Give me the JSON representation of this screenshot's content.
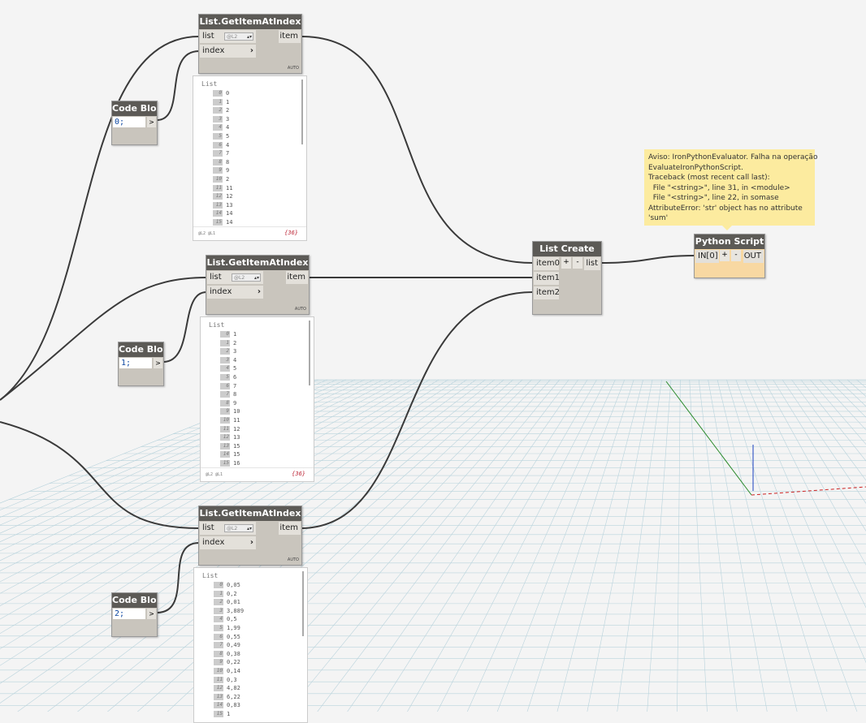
{
  "nodes": {
    "get1": {
      "title": "List.GetItemAtIndex",
      "in_list": "list",
      "in_index": "index",
      "out": "item",
      "level": "@L2",
      "lacing": "AUTO"
    },
    "get2": {
      "title": "List.GetItemAtIndex",
      "in_list": "list",
      "in_index": "index",
      "out": "item",
      "level": "@L2",
      "lacing": "AUTO"
    },
    "get3": {
      "title": "List.GetItemAtIndex",
      "in_list": "list",
      "in_index": "index",
      "out": "item",
      "level": "@L2",
      "lacing": "AUTO"
    },
    "code1": {
      "title": "Code Block",
      "code": "0;",
      "out": ">"
    },
    "code2": {
      "title": "Code Block",
      "code": "1;",
      "out": ">"
    },
    "code3": {
      "title": "Code Block",
      "code": "2;",
      "out": ">"
    },
    "listcreate": {
      "title": "List Create",
      "inputs": [
        "item0",
        "item1",
        "item2"
      ],
      "plus": "+",
      "minus": "-",
      "out": "list"
    },
    "python": {
      "title": "Python Script",
      "in": "IN[0]",
      "plus": "+",
      "minus": "-",
      "out": "OUT"
    }
  },
  "previews": [
    {
      "header": "List",
      "levels": "@L2 @L1",
      "count": "{36}",
      "rows": [
        [
          "0",
          "0"
        ],
        [
          "1",
          "1"
        ],
        [
          "2",
          "2"
        ],
        [
          "3",
          "3"
        ],
        [
          "4",
          "4"
        ],
        [
          "5",
          "5"
        ],
        [
          "6",
          "4"
        ],
        [
          "7",
          "7"
        ],
        [
          "8",
          "8"
        ],
        [
          "9",
          "9"
        ],
        [
          "10",
          "2"
        ],
        [
          "11",
          "11"
        ],
        [
          "12",
          "12"
        ],
        [
          "13",
          "13"
        ],
        [
          "14",
          "14"
        ],
        [
          "15",
          "14"
        ]
      ]
    },
    {
      "header": "List",
      "levels": "@L2 @L1",
      "count": "{36}",
      "rows": [
        [
          "0",
          "1"
        ],
        [
          "1",
          "2"
        ],
        [
          "2",
          "3"
        ],
        [
          "3",
          "4"
        ],
        [
          "4",
          "5"
        ],
        [
          "5",
          "6"
        ],
        [
          "6",
          "7"
        ],
        [
          "7",
          "8"
        ],
        [
          "8",
          "9"
        ],
        [
          "9",
          "10"
        ],
        [
          "10",
          "11"
        ],
        [
          "11",
          "12"
        ],
        [
          "12",
          "13"
        ],
        [
          "13",
          "15"
        ],
        [
          "14",
          "15"
        ],
        [
          "15",
          "16"
        ]
      ]
    },
    {
      "header": "List",
      "levels": "",
      "count": "",
      "rows": [
        [
          "0",
          "0,05"
        ],
        [
          "1",
          "0,2"
        ],
        [
          "2",
          "0,01"
        ],
        [
          "3",
          "3,889"
        ],
        [
          "4",
          "0,5"
        ],
        [
          "5",
          "1,99"
        ],
        [
          "6",
          "0,55"
        ],
        [
          "7",
          "0,49"
        ],
        [
          "8",
          "0,38"
        ],
        [
          "9",
          "0,22"
        ],
        [
          "10",
          "0,14"
        ],
        [
          "11",
          "0,3"
        ],
        [
          "12",
          "4,82"
        ],
        [
          "13",
          "6,22"
        ],
        [
          "14",
          "0,83"
        ],
        [
          "15",
          "1"
        ]
      ]
    }
  ],
  "tooltip": {
    "text": "Aviso: IronPythonEvaluator. Falha na operação\nEvaluateIronPythonScript.\nTraceback (most recent call last):\n  File \"<string>\", line 31, in <module>\n  File \"<string>\", line 22, in somase\nAttributeError: 'str' object has no attribute\n'sum'"
  },
  "colors": {
    "background": "#f4f4f4",
    "grid": "#b9d3dc",
    "node_header": "#5c5a56",
    "node_body": "#c9c5bd",
    "tooltip": "#fceb9f",
    "wire": "#3a3a3a"
  }
}
